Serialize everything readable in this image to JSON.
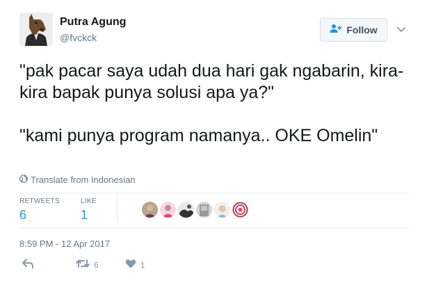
{
  "user": {
    "name": "Putra Agung",
    "handle": "@fvckck"
  },
  "follow_button": {
    "label": "Follow"
  },
  "tweet": {
    "paragraphs": [
      "\"pak pacar saya udah dua hari gak ngabarin, kira-kira bapak punya solusi apa ya?\"",
      "\"kami punya program namanya.. OKE Omelin\""
    ],
    "translate_label": "Translate from Indonesian"
  },
  "stats": {
    "retweets_label": "RETWEETS",
    "retweets_value": "6",
    "likes_label": "LIKE",
    "likes_value": "1"
  },
  "timestamp": "8:59 PM - 12 Apr 2017",
  "actions": {
    "retweet_count": "6",
    "like_count": "1"
  },
  "icons": {
    "follow": "add-user-icon",
    "more": "chevron-down-icon",
    "translate": "globe-icon",
    "reply": "reply-icon",
    "retweet": "retweet-icon",
    "like": "heart-icon"
  },
  "colors": {
    "link_blue": "#1b95e0",
    "muted": "#657786",
    "icon_gray": "#8899a6"
  }
}
